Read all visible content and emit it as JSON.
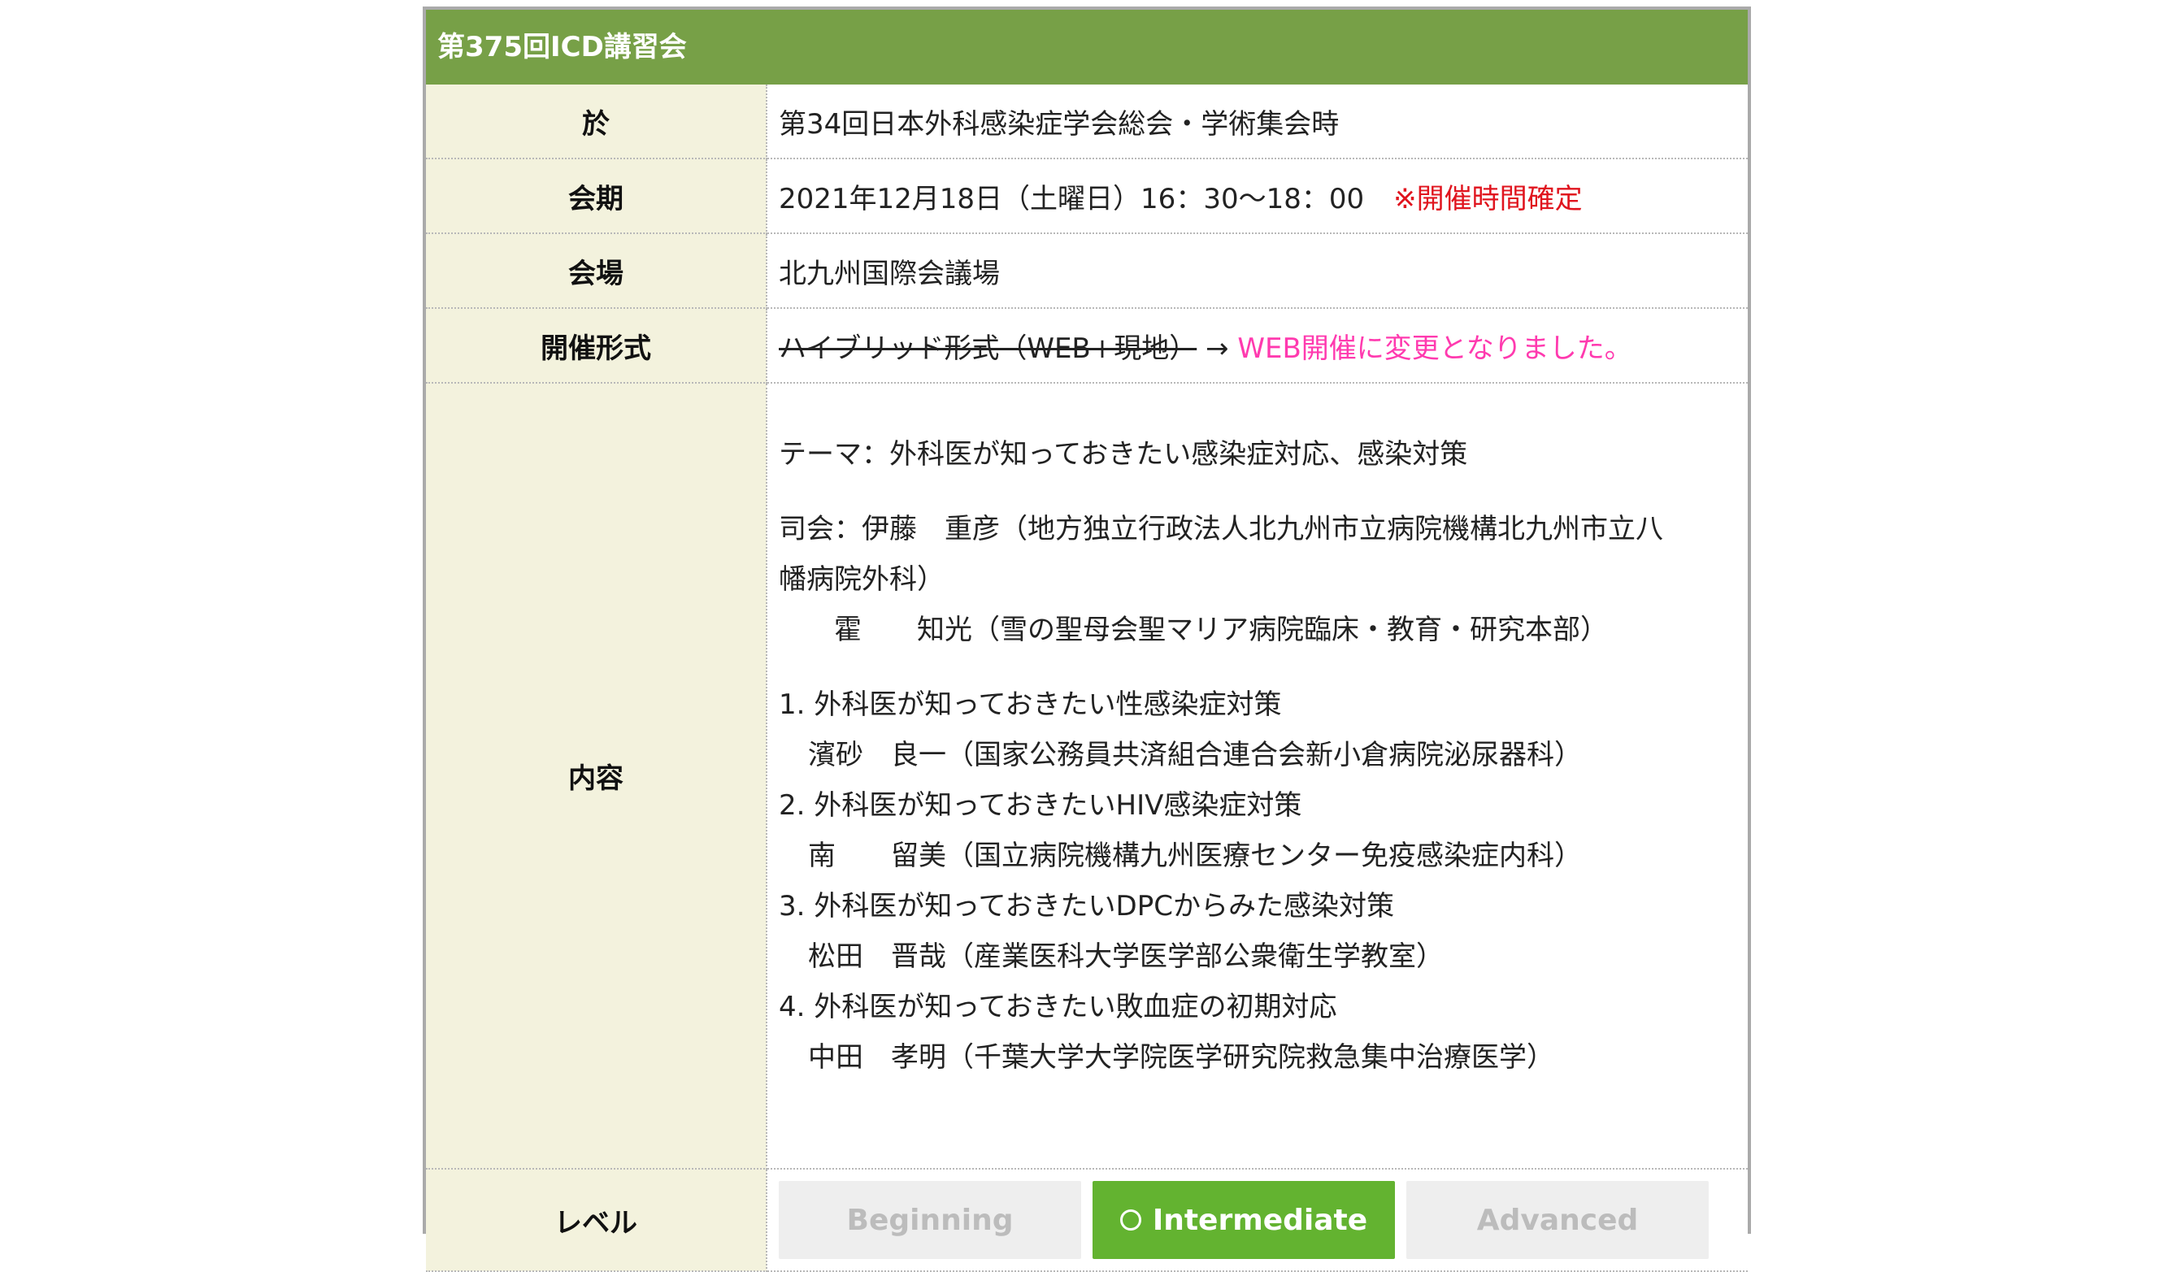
{
  "header": {
    "title": "第375回ICD講習会"
  },
  "rows": {
    "venue_event": {
      "label": "於",
      "value": "第34回日本外科感染症学会総会・学術集会時"
    },
    "date": {
      "label": "会期",
      "value": "2021年12月18日（土曜日）16：30〜18：00",
      "note": "※開催時間確定"
    },
    "place": {
      "label": "会場",
      "value": "北九州国際会議場"
    },
    "format": {
      "label": "開催形式",
      "old_value": "ハイブリッド形式（WEB+現地）",
      "arrow": "→",
      "new_value": "WEB開催に変更となりました。"
    },
    "content": {
      "label": "内容",
      "theme": "テーマ：外科医が知っておきたい感染症対応、感染対策",
      "chair_line1": "司会：伊藤　重彦（地方独立行政法人北九州市立病院機構北九州市立八",
      "chair_line2": "幡病院外科）",
      "chair2": "　　霍　　知光（雪の聖母会聖マリア病院臨床・教育・研究本部）",
      "talks": [
        {
          "title": "1.  外科医が知っておきたい性感染症対策",
          "speaker": "濱砂　良一（国家公務員共済組合連合会新小倉病院泌尿器科）"
        },
        {
          "title": "2.  外科医が知っておきたいHIV感染症対策",
          "speaker": "南　　留美（国立病院機構九州医療センター免疫感染症内科）"
        },
        {
          "title": "3.  外科医が知っておきたいDPCからみた感染対策",
          "speaker": "松田　晋哉（産業医科大学医学部公衆衛生学教室）"
        },
        {
          "title": "4.  外科医が知っておきたい敗血症の初期対応",
          "speaker": "中田　孝明（千葉大学大学院医学研究院救急集中治療医学）"
        }
      ]
    },
    "level": {
      "label": "レベル",
      "options": [
        {
          "label": "Beginning",
          "active": false
        },
        {
          "label": "Intermediate",
          "active": true
        },
        {
          "label": "Advanced",
          "active": false
        }
      ]
    }
  },
  "colors": {
    "header_bg": "#77a047",
    "label_bg": "#f3f2dd",
    "note_red": "#e0141e",
    "note_pink": "#ff3aaf",
    "active_level": "#63b330"
  }
}
